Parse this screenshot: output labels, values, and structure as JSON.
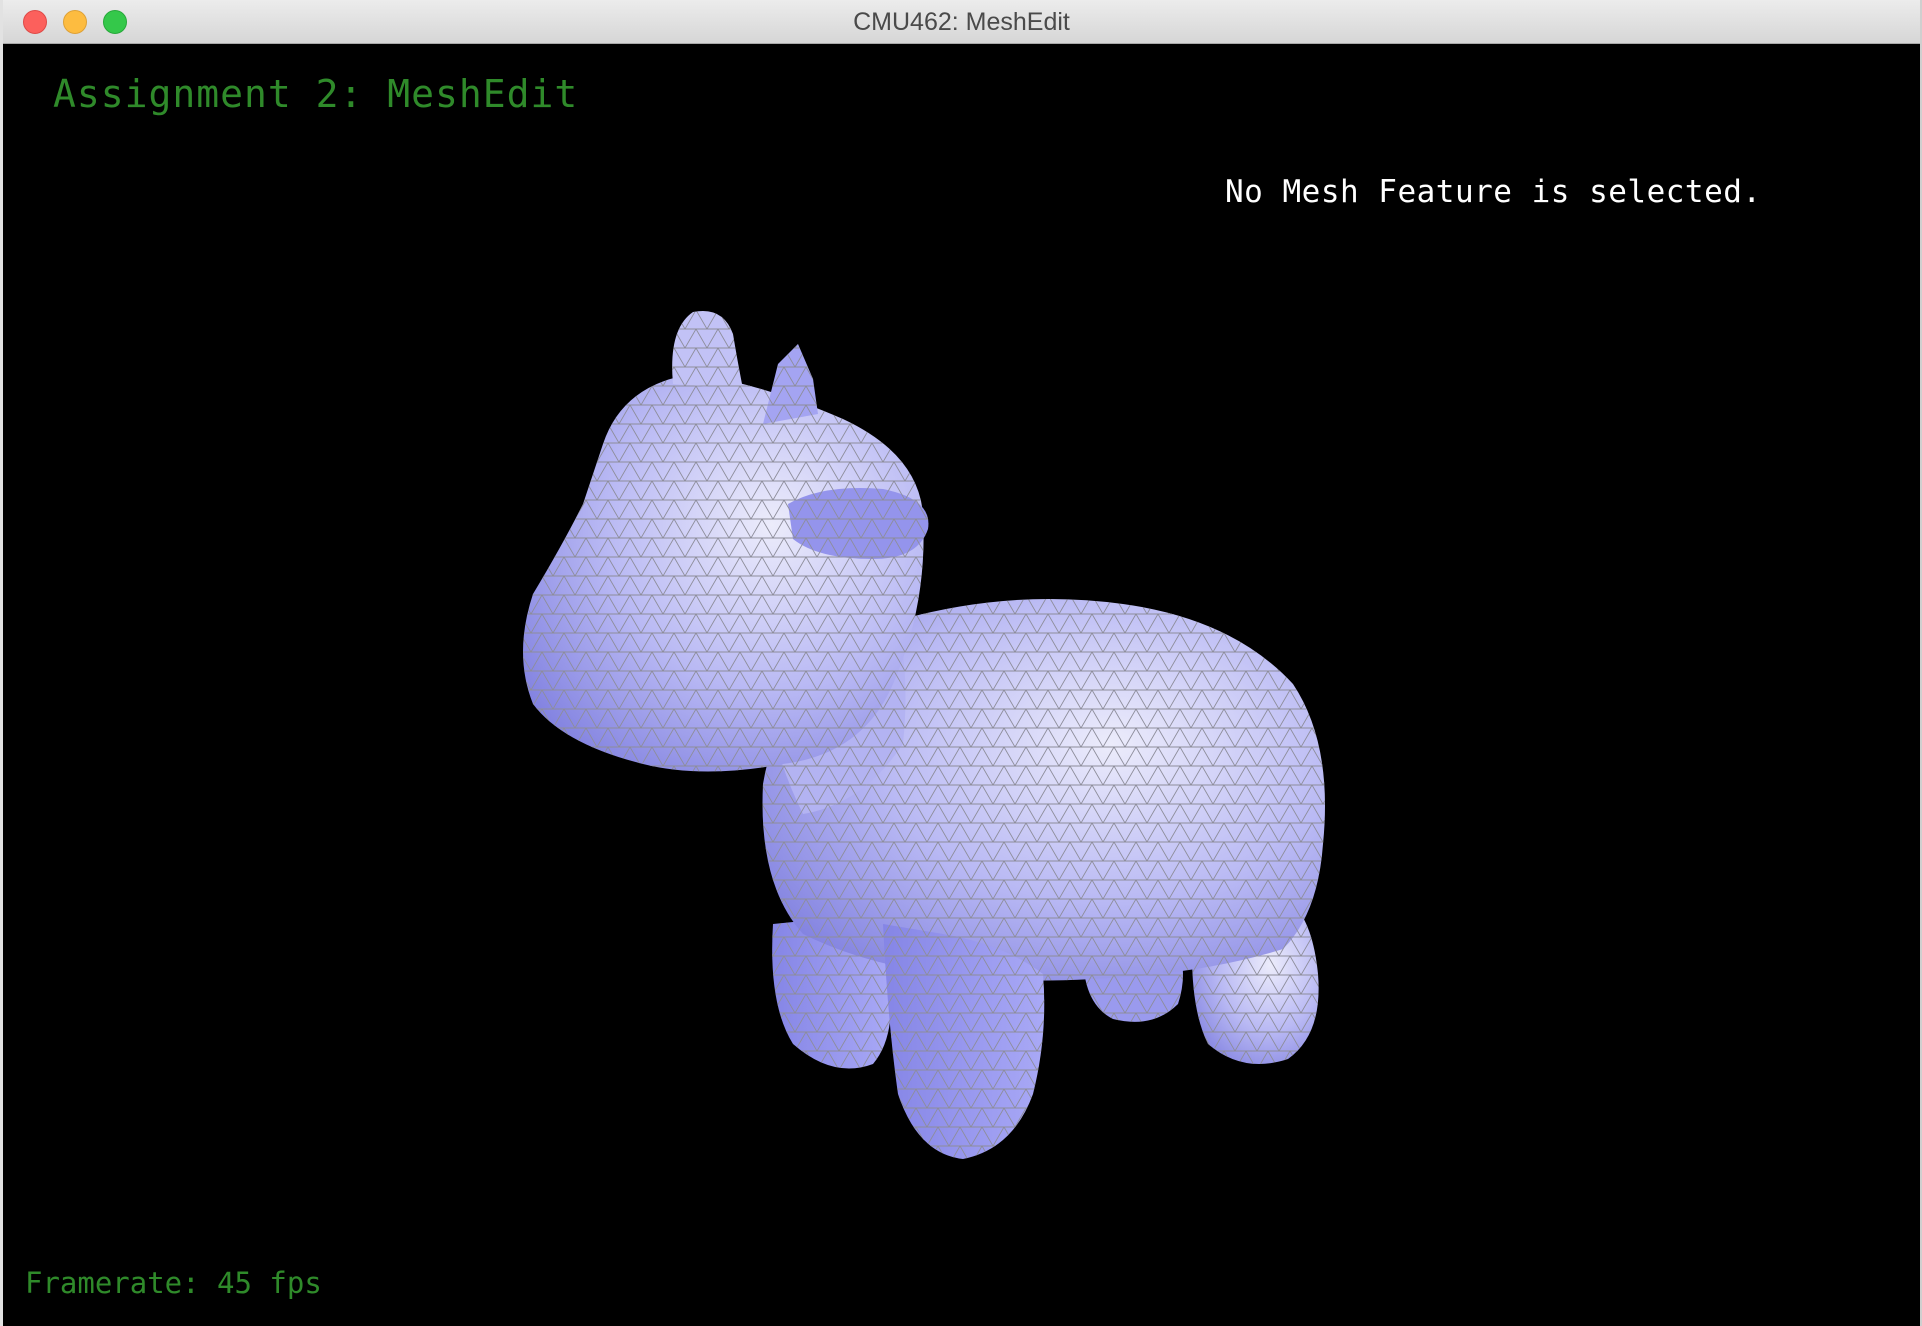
{
  "window": {
    "title": "CMU462: MeshEdit"
  },
  "overlay": {
    "app_title": "Assignment 2: MeshEdit",
    "selection_status": "No Mesh Feature is selected.",
    "framerate": "Framerate: 45 fps"
  },
  "colors": {
    "mesh_fill": "#a8a8f8",
    "mesh_edges": "#8a8a8a",
    "overlay_green": "#2f8a2a",
    "background": "#000000"
  },
  "icons": [
    "close-icon",
    "minimize-icon",
    "zoom-icon"
  ]
}
